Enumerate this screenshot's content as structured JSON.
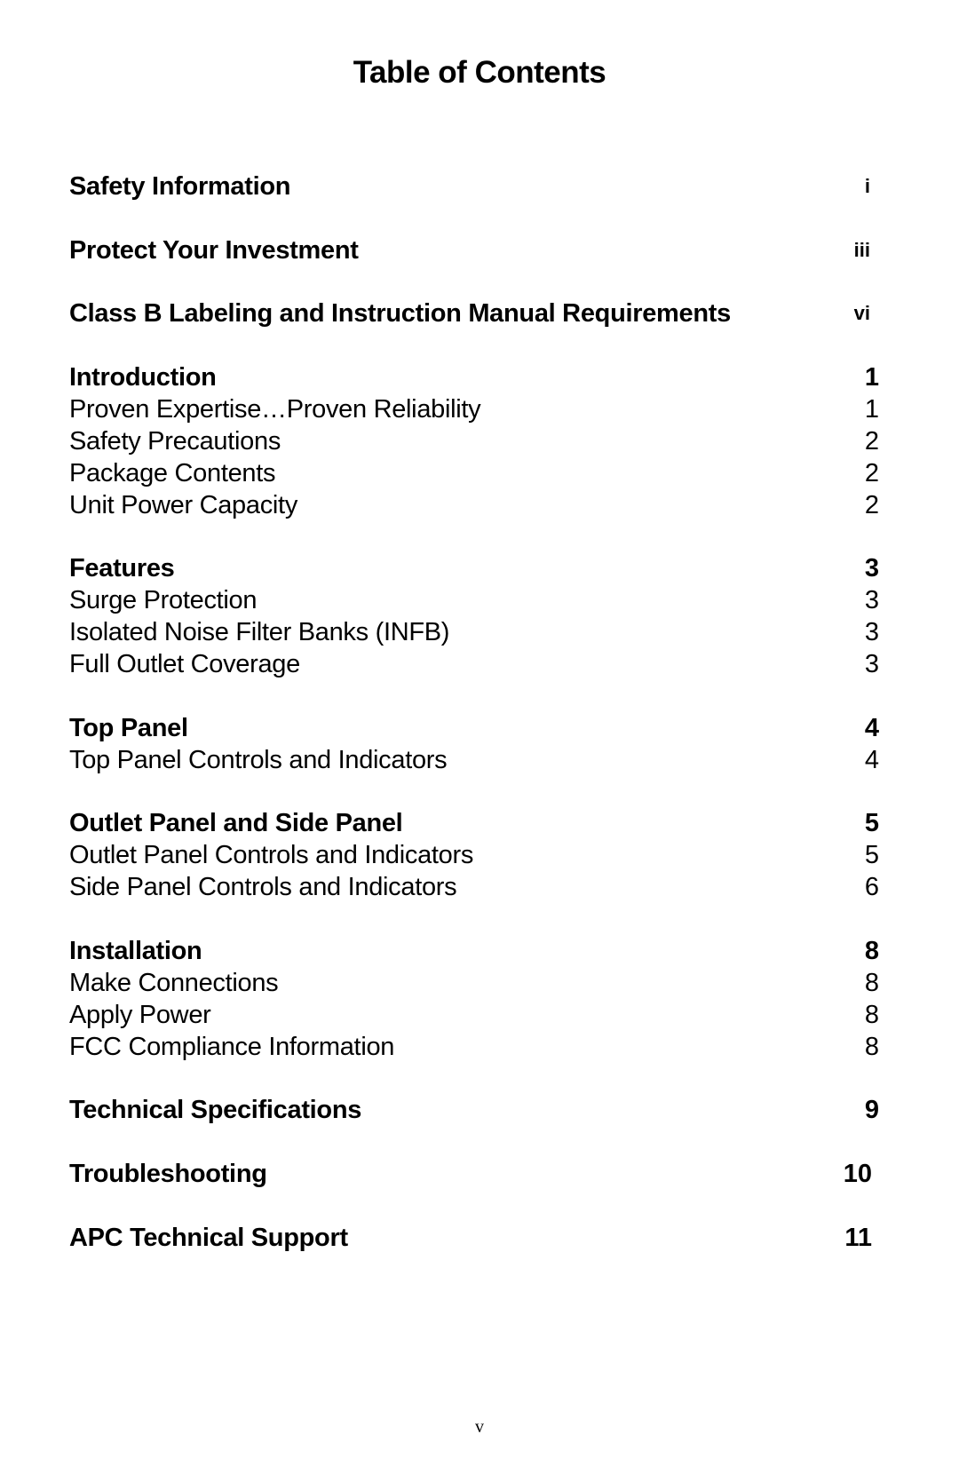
{
  "title": "Table of Contents",
  "entries": [
    {
      "label": "Safety Information",
      "page": "i",
      "level": "heading"
    },
    {
      "label": "Protect Your Investment",
      "page": "iii",
      "level": "heading"
    },
    {
      "label": "Class B Labeling and Instruction Manual Requirements",
      "page": "vi",
      "level": "heading"
    },
    {
      "label": "Introduction",
      "page": "1",
      "level": "heading"
    },
    {
      "label": "Proven Expertise…Proven Reliability",
      "page": "1",
      "level": "sub"
    },
    {
      "label": "Safety Precautions",
      "page": "2",
      "level": "sub"
    },
    {
      "label": "Package Contents",
      "page": "2",
      "level": "sub"
    },
    {
      "label": "Unit Power Capacity",
      "page": "2",
      "level": "sub"
    },
    {
      "label": "Features",
      "page": "3",
      "level": "heading"
    },
    {
      "label": "Surge Protection",
      "page": "3",
      "level": "sub"
    },
    {
      "label": "Isolated Noise Filter Banks (INFB)",
      "page": "3",
      "level": "sub"
    },
    {
      "label": "Full Outlet Coverage",
      "page": "3",
      "level": "sub"
    },
    {
      "label": "Top Panel",
      "page": "4",
      "level": "heading"
    },
    {
      "label": "Top Panel Controls and Indicators",
      "page": "4",
      "level": "sub"
    },
    {
      "label": "Outlet Panel and Side Panel",
      "page": "5",
      "level": "heading"
    },
    {
      "label": "Outlet Panel Controls and Indicators",
      "page": "5",
      "level": "sub"
    },
    {
      "label": "Side Panel Controls and Indicators",
      "page": "6",
      "level": "sub"
    },
    {
      "label": "Installation",
      "page": "8",
      "level": "heading"
    },
    {
      "label": "Make Connections",
      "page": "8",
      "level": "sub"
    },
    {
      "label": "Apply Power",
      "page": "8",
      "level": "sub"
    },
    {
      "label": "FCC Compliance Information",
      "page": "8",
      "level": "sub"
    },
    {
      "label": "Technical Specifications",
      "page": "9",
      "level": "heading"
    },
    {
      "label": "Troubleshooting",
      "page": "10",
      "level": "heading"
    },
    {
      "label": "APC Technical Support",
      "page": "11",
      "level": "heading"
    }
  ],
  "footer_page_number": "v"
}
